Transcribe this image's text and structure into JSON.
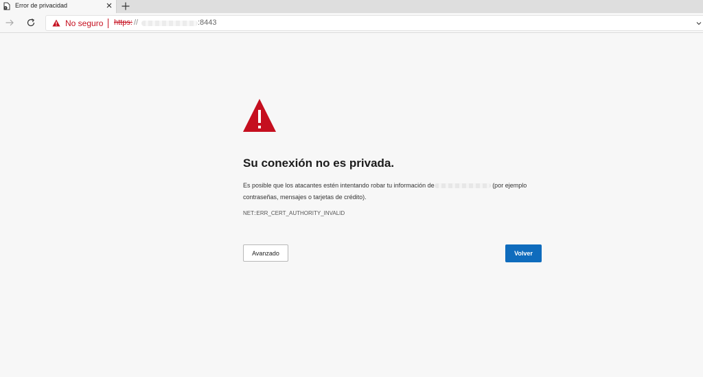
{
  "tab": {
    "title": "Error de privacidad"
  },
  "omnibox": {
    "security_label": "No seguro",
    "url_scheme": "https:",
    "url_slashes": "//",
    "url_port": ":8443"
  },
  "interstitial": {
    "heading": "Su conexión no es privada.",
    "description_before": "Es posible que los atacantes estén intentando robar tu información de",
    "description_after": " (por ejemplo contraseñas, mensajes o tarjetas de crédito).",
    "error_code": "NET::ERR_CERT_AUTHORITY_INVALID",
    "advanced_button": "Avanzado",
    "back_button": "Volver"
  },
  "colors": {
    "danger": "#c50f1f",
    "primary_button": "#0f6cbd",
    "page_background": "#f7f7f7"
  },
  "icons": {
    "tab_favicon": "page-error-icon",
    "tab_close": "close-icon",
    "new_tab": "plus-icon",
    "forward": "arrow-right-icon",
    "reload": "refresh-icon",
    "security": "warning-triangle-icon",
    "dropdown": "chevron-down-icon"
  }
}
